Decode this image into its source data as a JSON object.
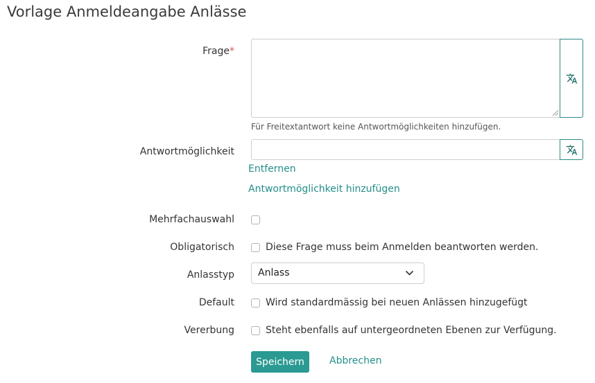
{
  "page": {
    "title": "Vorlage Anmeldeangabe Anlässe"
  },
  "form": {
    "frage": {
      "label": "Frage",
      "required_mark": "*",
      "help": "Für Freitextantwort keine Antwortmöglichkeiten hinzufügen."
    },
    "antwort": {
      "label": "Antwortmöglichkeit",
      "remove_link": "Entfernen",
      "add_link": "Antwortmöglichkeit hinzufügen"
    },
    "mehrfach": {
      "label": "Mehrfachauswahl"
    },
    "obligatorisch": {
      "label": "Obligatorisch",
      "text": "Diese Frage muss beim Anmelden beantworten werden."
    },
    "anlasstyp": {
      "label": "Anlasstyp",
      "selected": "Anlass"
    },
    "default": {
      "label": "Default",
      "text": "Wird standardmässig bei neuen Anlässen hinzugefügt"
    },
    "vererbung": {
      "label": "Vererbung",
      "text": "Steht ebenfalls auf untergeordneten Ebenen zur Verfügung."
    },
    "actions": {
      "save": "Speichern",
      "cancel": "Abbrechen"
    }
  },
  "icons": {
    "translate": "translate-icon",
    "select_arrow": "chevron-down-icon"
  },
  "colors": {
    "accent": "#2a9a92",
    "link": "#238f8a",
    "required": "#d9534f"
  }
}
